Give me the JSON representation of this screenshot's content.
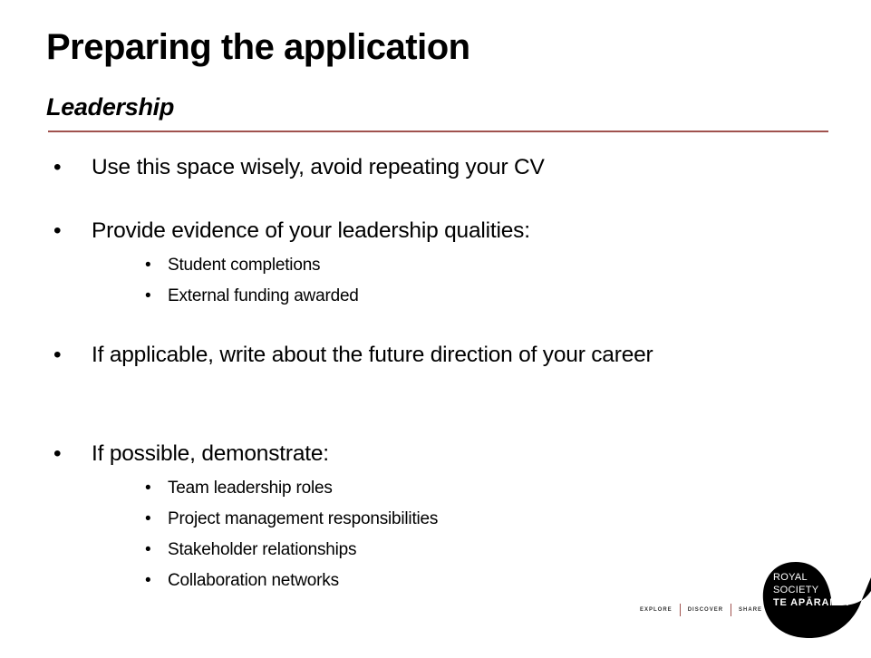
{
  "slide": {
    "title": "Preparing the application",
    "subtitle": "Leadership",
    "accent_color": "#a0524e",
    "bullets": [
      {
        "text": "Use this space wisely, avoid repeating your CV"
      },
      {
        "text": "Provide evidence of your leadership qualities:",
        "sub": [
          "Student completions",
          "External funding awarded"
        ]
      },
      {
        "text": "If applicable, write about the future direction of your career"
      },
      {
        "text": "If possible, demonstrate:",
        "sub": [
          "Team leadership roles",
          "Project management responsibilities",
          "Stakeholder relationships",
          "Collaboration networks"
        ]
      }
    ],
    "bullet_glyph": "•"
  },
  "footer": {
    "nav": [
      "EXPLORE",
      "DISCOVER",
      "SHARE"
    ],
    "logo": {
      "line1": "ROYAL",
      "line2": "SOCIETY",
      "line3": "TE APĀRANGI"
    }
  }
}
